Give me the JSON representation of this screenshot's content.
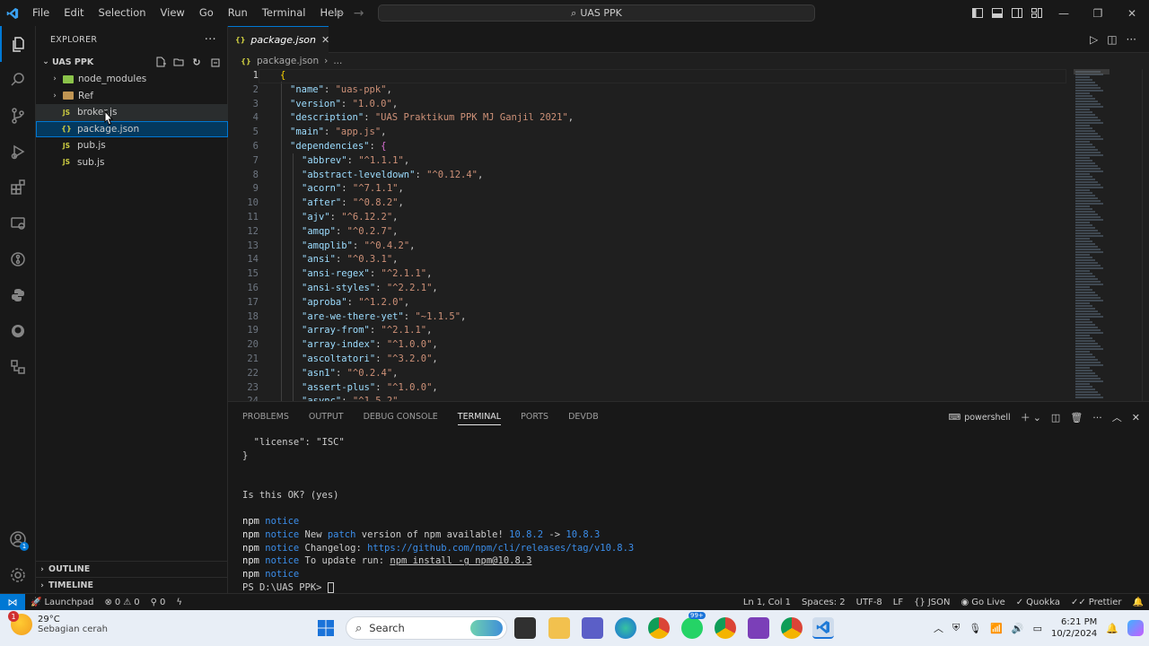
{
  "menu": [
    "File",
    "Edit",
    "Selection",
    "View",
    "Go",
    "Run",
    "Terminal",
    "Help"
  ],
  "command_center": "UAS PPK",
  "explorer": {
    "title": "EXPLORER",
    "folder": "UAS PPK",
    "items": [
      {
        "name": "node_modules",
        "type": "folder",
        "color": "#8bc34a"
      },
      {
        "name": "Ref",
        "type": "folder",
        "color": "#c09553"
      },
      {
        "name": "broker.js",
        "type": "js"
      },
      {
        "name": "package.json",
        "type": "json"
      },
      {
        "name": "pub.js",
        "type": "js"
      },
      {
        "name": "sub.js",
        "type": "js"
      }
    ],
    "outline": "OUTLINE",
    "timeline": "TIMELINE"
  },
  "editor": {
    "tab": "package.json",
    "breadcrumb": "package.json",
    "breadcrumb_more": "...",
    "lines": [
      {
        "n": "1",
        "text": "{"
      },
      {
        "n": "2",
        "key": "\"name\"",
        "value": "\"uas-ppk\"",
        "tail": ","
      },
      {
        "n": "3",
        "key": "\"version\"",
        "value": "\"1.0.0\"",
        "tail": ","
      },
      {
        "n": "4",
        "key": "\"description\"",
        "value": "\"UAS Praktikum PPK MJ Ganjil 2021\"",
        "tail": ","
      },
      {
        "n": "5",
        "key": "\"main\"",
        "value": "\"app.js\"",
        "tail": ","
      },
      {
        "n": "6",
        "key": "\"dependencies\"",
        "value": "",
        "tail": "{"
      },
      {
        "n": "7",
        "key": "\"abbrev\"",
        "value": "\"^1.1.1\"",
        "tail": ","
      },
      {
        "n": "8",
        "key": "\"abstract-leveldown\"",
        "value": "\"^0.12.4\"",
        "tail": ","
      },
      {
        "n": "9",
        "key": "\"acorn\"",
        "value": "\"^7.1.1\"",
        "tail": ","
      },
      {
        "n": "10",
        "key": "\"after\"",
        "value": "\"^0.8.2\"",
        "tail": ","
      },
      {
        "n": "11",
        "key": "\"ajv\"",
        "value": "\"^6.12.2\"",
        "tail": ","
      },
      {
        "n": "12",
        "key": "\"amqp\"",
        "value": "\"^0.2.7\"",
        "tail": ","
      },
      {
        "n": "13",
        "key": "\"amqplib\"",
        "value": "\"^0.4.2\"",
        "tail": ","
      },
      {
        "n": "14",
        "key": "\"ansi\"",
        "value": "\"^0.3.1\"",
        "tail": ","
      },
      {
        "n": "15",
        "key": "\"ansi-regex\"",
        "value": "\"^2.1.1\"",
        "tail": ","
      },
      {
        "n": "16",
        "key": "\"ansi-styles\"",
        "value": "\"^2.2.1\"",
        "tail": ","
      },
      {
        "n": "17",
        "key": "\"aproba\"",
        "value": "\"^1.2.0\"",
        "tail": ","
      },
      {
        "n": "18",
        "key": "\"are-we-there-yet\"",
        "value": "\"~1.1.5\"",
        "tail": ","
      },
      {
        "n": "19",
        "key": "\"array-from\"",
        "value": "\"^2.1.1\"",
        "tail": ","
      },
      {
        "n": "20",
        "key": "\"array-index\"",
        "value": "\"^1.0.0\"",
        "tail": ","
      },
      {
        "n": "21",
        "key": "\"ascoltatori\"",
        "value": "\"^3.2.0\"",
        "tail": ","
      },
      {
        "n": "22",
        "key": "\"asn1\"",
        "value": "\"^0.2.4\"",
        "tail": ","
      },
      {
        "n": "23",
        "key": "\"assert-plus\"",
        "value": "\"^1.0.0\"",
        "tail": ","
      },
      {
        "n": "24",
        "key": "\"async\"",
        "value": "\"^1.5.2\"",
        "tail": ","
      }
    ]
  },
  "panel": {
    "tabs": [
      "PROBLEMS",
      "OUTPUT",
      "DEBUG CONSOLE",
      "TERMINAL",
      "PORTS",
      "DEVDB"
    ],
    "active_tab": "TERMINAL",
    "shell": "powershell",
    "terminal": {
      "license_line": "  \"license\": \"ISC\"",
      "close_brace": "}",
      "question": "Is this OK? (yes)",
      "npm": "npm",
      "notice": "notice",
      "l2_a": " New ",
      "l2_patch": "patch",
      "l2_b": " version of npm available! ",
      "l2_old": "10.8.2",
      "l2_arrow": " -> ",
      "l2_new": "10.8.3",
      "l3_a": " Changelog: ",
      "l3_link": "https://github.com/npm/cli/releases/tag/v10.8.3",
      "l4_a": " To update run: ",
      "l4_cmd": "npm install -g npm@10.8.3",
      "prompt": "PS D:\\UAS PPK> "
    }
  },
  "statusbar": {
    "launchpad": "Launchpad",
    "errors": "0",
    "warnings": "0",
    "ports": "0",
    "position": "Ln 1, Col 1",
    "spaces": "Spaces: 2",
    "encoding": "UTF-8",
    "eol": "LF",
    "language": "JSON",
    "golive": "Go Live",
    "quokka": "Quokka",
    "prettier": "Prettier"
  },
  "taskbar": {
    "temp": "29°C",
    "weather": "Sebagian cerah",
    "weather_badge": "1",
    "search": "Search",
    "teams_badge": "99+",
    "time": "6:21 PM",
    "date": "10/2/2024"
  }
}
